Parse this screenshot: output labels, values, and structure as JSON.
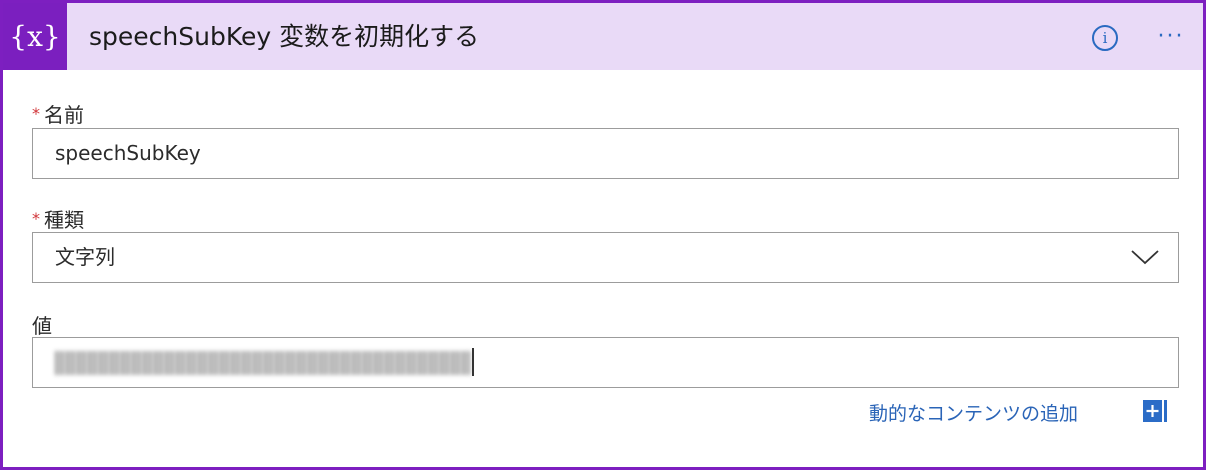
{
  "header": {
    "icon_symbol": "{x}",
    "title": "speechSubKey 変数を初期化する",
    "info_label": "i",
    "more_label": "···",
    "accent_color": "#7b1fbf",
    "header_bg": "#e9daf7"
  },
  "fields": {
    "name": {
      "required_mark": "*",
      "label": "名前",
      "value": "speechSubKey"
    },
    "type": {
      "required_mark": "*",
      "label": "種類",
      "value": "文字列"
    },
    "value": {
      "label": "値",
      "redacted": true
    }
  },
  "dynamic_content": {
    "label": "動的なコンテンツの追加"
  }
}
